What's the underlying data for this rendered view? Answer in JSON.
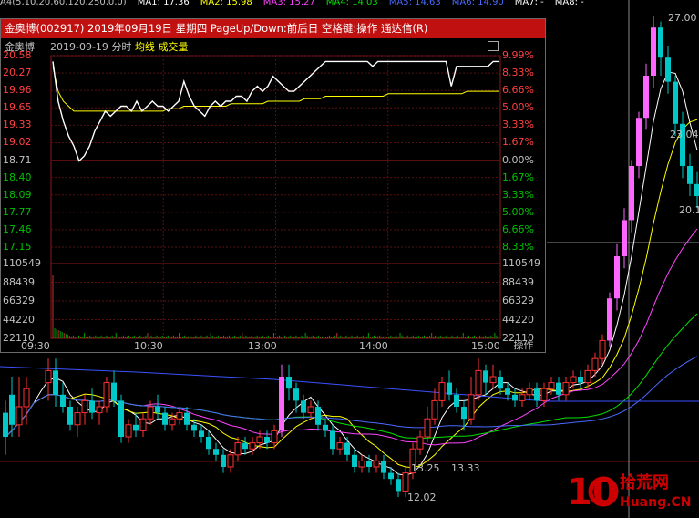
{
  "ma_bar": [
    {
      "text": "A4(5,10,20,60,120,250,0,0)",
      "color": "#c0c0c0"
    },
    {
      "text": "MA1: 17.36",
      "color": "#ffffff"
    },
    {
      "text": "MA2: 15.98",
      "color": "#ffff00"
    },
    {
      "text": "MA3: 15.27",
      "color": "#ff44ff"
    },
    {
      "text": "MA4: 14.03",
      "color": "#00e000"
    },
    {
      "text": "MA5: 14.63",
      "color": "#4a6bff"
    },
    {
      "text": "MA6: 14.90",
      "color": "#4a6bff"
    },
    {
      "text": "MA7: -",
      "color": "#ffffff"
    },
    {
      "text": "MA8: -",
      "color": "#ffffff"
    }
  ],
  "kline": {
    "labels": {
      "high": "27.00",
      "price_23": "23.04",
      "price_20": "20.1",
      "range_low": "13.25",
      "range_high": "13.33",
      "low": "12.02"
    },
    "candles": [
      [
        3,
        14,
        10,
        16,
        7
      ],
      [
        10,
        17,
        12,
        20,
        10
      ],
      [
        18,
        12,
        15,
        20,
        10
      ],
      [
        26,
        15,
        18,
        20,
        12
      ],
      [
        34,
        20,
        23,
        24,
        17
      ],
      [
        42,
        22,
        20,
        25,
        18
      ],
      [
        50,
        19,
        21,
        23,
        16
      ],
      [
        58,
        21,
        17,
        23,
        15
      ],
      [
        66,
        17,
        15,
        19,
        14
      ],
      [
        74,
        15,
        12,
        16,
        11
      ],
      [
        82,
        12,
        14,
        15,
        10
      ],
      [
        90,
        14,
        16,
        17,
        12
      ],
      [
        98,
        16,
        14,
        18,
        13
      ],
      [
        106,
        14,
        15,
        16,
        12
      ],
      [
        114,
        15,
        19,
        20,
        14
      ],
      [
        122,
        19,
        16,
        21,
        15
      ],
      [
        130,
        16,
        10,
        17,
        9
      ],
      [
        138,
        10,
        12,
        13,
        9
      ],
      [
        146,
        12,
        11,
        14,
        10
      ],
      [
        154,
        11,
        13,
        14,
        10
      ],
      [
        162,
        13,
        15,
        16,
        12
      ],
      [
        170,
        15,
        14,
        17,
        13
      ],
      [
        178,
        14,
        12,
        15,
        11
      ],
      [
        186,
        12,
        13,
        14,
        11
      ],
      [
        194,
        13,
        14,
        15,
        12
      ],
      [
        202,
        14,
        12,
        15,
        11
      ],
      [
        210,
        12,
        11,
        13,
        10
      ],
      [
        218,
        11,
        10,
        12,
        9
      ],
      [
        226,
        10,
        8,
        11,
        7
      ],
      [
        234,
        8,
        7,
        9,
        6
      ],
      [
        242,
        7,
        5,
        8,
        4
      ],
      [
        250,
        5,
        7,
        8,
        4
      ],
      [
        258,
        7,
        9,
        10,
        6
      ],
      [
        266,
        9,
        8,
        10,
        7
      ],
      [
        274,
        8,
        9,
        10,
        7
      ],
      [
        282,
        9,
        10,
        11,
        8
      ],
      [
        290,
        10,
        9,
        11,
        8
      ],
      [
        298,
        9,
        11,
        12,
        8
      ],
      [
        306,
        11,
        20,
        22,
        10
      ],
      [
        314,
        20,
        18,
        22,
        16
      ],
      [
        322,
        18,
        16,
        19,
        14
      ],
      [
        330,
        16,
        14,
        17,
        13
      ],
      [
        338,
        14,
        15,
        16,
        13
      ],
      [
        346,
        15,
        12,
        16,
        11
      ],
      [
        354,
        12,
        11,
        13,
        10
      ],
      [
        362,
        11,
        8,
        12,
        7
      ],
      [
        370,
        8,
        9,
        10,
        7
      ],
      [
        378,
        9,
        7,
        10,
        6
      ],
      [
        386,
        7,
        5,
        8,
        4
      ],
      [
        394,
        5,
        6,
        7,
        4
      ],
      [
        402,
        6,
        5,
        7,
        4
      ],
      [
        410,
        5,
        6,
        7,
        4
      ],
      [
        418,
        6,
        4,
        7,
        3
      ],
      [
        426,
        4,
        3,
        5,
        2
      ],
      [
        434,
        3,
        1,
        4,
        0
      ],
      [
        442,
        1,
        4,
        5,
        0
      ],
      [
        450,
        4,
        8,
        9,
        3
      ],
      [
        458,
        8,
        10,
        11,
        7
      ],
      [
        466,
        10,
        13,
        15,
        9
      ],
      [
        474,
        13,
        16,
        18,
        12
      ],
      [
        482,
        16,
        19,
        20,
        15
      ],
      [
        490,
        19,
        17,
        21,
        16
      ],
      [
        498,
        17,
        15,
        18,
        14
      ],
      [
        506,
        15,
        13,
        16,
        11
      ],
      [
        514,
        13,
        17,
        20,
        12
      ],
      [
        522,
        17,
        21,
        23,
        16
      ],
      [
        530,
        21,
        19,
        22,
        17
      ],
      [
        538,
        19,
        20,
        22,
        18
      ],
      [
        546,
        20,
        18,
        21,
        17
      ],
      [
        554,
        18,
        17,
        19,
        16
      ],
      [
        562,
        17,
        16,
        18,
        15
      ],
      [
        570,
        16,
        17,
        18,
        15
      ],
      [
        578,
        17,
        18,
        19,
        16
      ],
      [
        586,
        18,
        16,
        19,
        15
      ],
      [
        594,
        16,
        18,
        19,
        15
      ],
      [
        602,
        18,
        19,
        20,
        17
      ],
      [
        610,
        19,
        17,
        20,
        16
      ],
      [
        618,
        17,
        19,
        20,
        16
      ],
      [
        626,
        19,
        20,
        21,
        18
      ],
      [
        634,
        20,
        19,
        21,
        18
      ],
      [
        642,
        19,
        21,
        22,
        18
      ],
      [
        650,
        21,
        23,
        24,
        20
      ],
      [
        658,
        23,
        26,
        27,
        22
      ],
      [
        666,
        26,
        33,
        34,
        25
      ],
      [
        674,
        33,
        40,
        42,
        31
      ],
      [
        682,
        40,
        46,
        48,
        38
      ],
      [
        690,
        46,
        55,
        56,
        44
      ],
      [
        698,
        55,
        63,
        64,
        53
      ],
      [
        706,
        63,
        70,
        72,
        61
      ],
      [
        714,
        70,
        78,
        80,
        68
      ],
      [
        722,
        78,
        73,
        79,
        70
      ],
      [
        730,
        73,
        69,
        75,
        67
      ],
      [
        738,
        69,
        62,
        70,
        60
      ],
      [
        746,
        62,
        55,
        64,
        53
      ],
      [
        754,
        55,
        52,
        57,
        50
      ],
      [
        762,
        52,
        50,
        54,
        48
      ]
    ]
  },
  "popup": {
    "title": "金奥博(002917) 2019年09月19日 星期四 PageUp/Down:前后日 空格键:操作 通达信(R)",
    "stock_name": "金奥博",
    "date": "2019-09-19",
    "chart_type": "分时",
    "avg_line_label": "均线",
    "volume_label": "成交量",
    "operate_label": "操作",
    "price_axis": [
      "20.58",
      "20.27",
      "19.96",
      "19.65",
      "19.33",
      "19.02",
      "18.71",
      "18.40",
      "18.09",
      "17.77",
      "17.46",
      "17.15"
    ],
    "pct_axis": [
      "9.99%",
      "8.33%",
      "6.66%",
      "5.00%",
      "3.33%",
      "1.67%",
      "0.00%",
      "1.67%",
      "3.33%",
      "5.00%",
      "6.66%",
      "8.33%"
    ],
    "volume_axis": [
      "110549",
      "88439",
      "66329",
      "44220",
      "22110"
    ],
    "time_axis": [
      "09:30",
      "10:30",
      "13:00",
      "14:00",
      "15:00"
    ]
  },
  "intraday": {
    "prev_close": 18.71,
    "limit_up": 20.58,
    "limit_down": 16.84,
    "price": [
      20.5,
      19.7,
      19.3,
      19.0,
      18.8,
      18.5,
      18.6,
      18.8,
      19.1,
      19.3,
      19.5,
      19.4,
      19.5,
      19.6,
      19.6,
      19.5,
      19.7,
      19.5,
      19.6,
      19.7,
      19.6,
      19.6,
      19.5,
      19.6,
      19.7,
      20.1,
      19.8,
      19.6,
      19.5,
      19.4,
      19.6,
      19.7,
      19.6,
      19.7,
      19.7,
      19.8,
      19.8,
      19.7,
      19.9,
      20.0,
      19.9,
      20.0,
      20.2,
      20.1,
      20.0,
      19.9,
      19.9,
      20.0,
      20.1,
      20.2,
      20.3,
      20.4,
      20.5,
      20.5,
      20.5,
      20.5,
      20.5,
      20.5,
      20.5,
      20.5,
      20.5,
      20.4,
      20.5,
      20.5,
      20.5,
      20.5,
      20.5,
      20.5,
      20.5,
      20.5,
      20.5,
      20.5,
      20.5,
      20.5,
      20.5,
      20.5,
      20.0,
      20.4,
      20.4,
      20.4,
      20.4,
      20.4,
      20.4,
      20.4,
      20.5,
      20.5
    ],
    "avg": [
      20.4,
      19.9,
      19.7,
      19.6,
      19.5,
      19.5,
      19.5,
      19.5,
      19.5,
      19.5,
      19.5,
      19.5,
      19.5,
      19.5,
      19.5,
      19.5,
      19.5,
      19.5,
      19.5,
      19.5,
      19.5,
      19.5,
      19.55,
      19.55,
      19.55,
      19.6,
      19.6,
      19.6,
      19.6,
      19.6,
      19.6,
      19.6,
      19.6,
      19.6,
      19.65,
      19.65,
      19.65,
      19.65,
      19.65,
      19.65,
      19.65,
      19.7,
      19.7,
      19.7,
      19.7,
      19.7,
      19.7,
      19.7,
      19.75,
      19.75,
      19.75,
      19.75,
      19.8,
      19.8,
      19.8,
      19.8,
      19.8,
      19.8,
      19.8,
      19.8,
      19.8,
      19.8,
      19.8,
      19.8,
      19.85,
      19.85,
      19.85,
      19.85,
      19.85,
      19.85,
      19.85,
      19.85,
      19.85,
      19.85,
      19.85,
      19.85,
      19.85,
      19.85,
      19.85,
      19.9,
      19.9,
      19.9,
      19.9,
      19.9,
      19.9,
      19.9
    ],
    "volume_peak": 110549
  },
  "logo": {
    "text_cn": "拾荒网",
    "text_en": "Huang.CN",
    "digits": "10"
  }
}
